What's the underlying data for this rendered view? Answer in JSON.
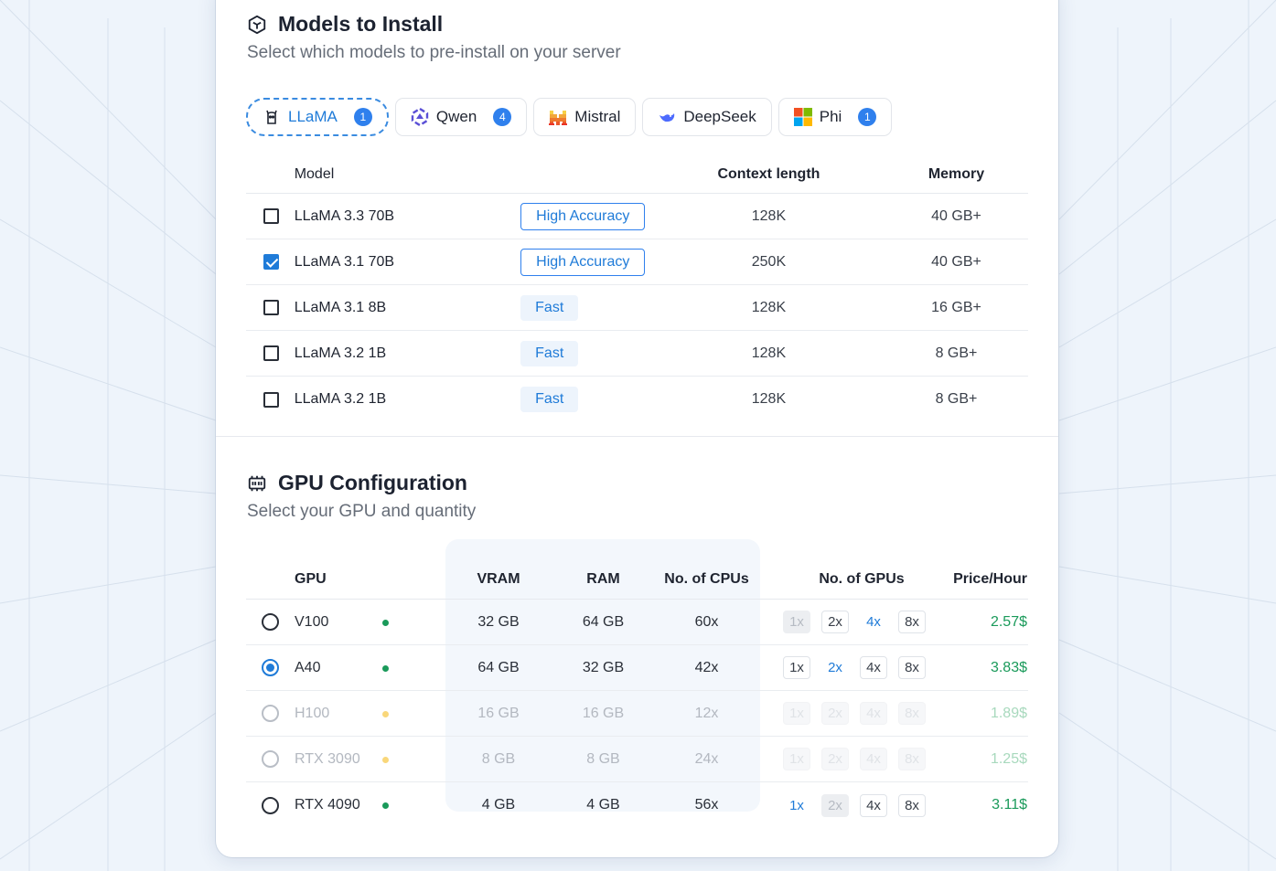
{
  "models_section": {
    "title": "Models to Install",
    "subtitle": "Select which models to pre-install on your server",
    "tabs": [
      {
        "label": "LLaMA",
        "count": "1",
        "active": true
      },
      {
        "label": "Qwen",
        "count": "4"
      },
      {
        "label": "Mistral",
        "count": ""
      },
      {
        "label": "DeepSeek",
        "count": ""
      },
      {
        "label": "Phi",
        "count": "1"
      }
    ],
    "headers": {
      "model": "Model",
      "context": "Context length",
      "memory": "Memory"
    },
    "rows": [
      {
        "name": "LLaMA 3.3 70B",
        "tag": "High Accuracy",
        "context": "128K",
        "memory": "40 GB+",
        "checked": false
      },
      {
        "name": "LLaMA 3.1 70B",
        "tag": "High Accuracy",
        "context": "250K",
        "memory": "40 GB+",
        "checked": true
      },
      {
        "name": "LLaMA 3.1 8B",
        "tag": "Fast",
        "context": "128K",
        "memory": "16 GB+",
        "checked": false
      },
      {
        "name": "LLaMA 3.2 1B",
        "tag": "Fast",
        "context": "128K",
        "memory": "8 GB+",
        "checked": false
      },
      {
        "name": "LLaMA 3.2 1B",
        "tag": "Fast",
        "context": "128K",
        "memory": "8 GB+",
        "checked": false
      }
    ]
  },
  "gpu_section": {
    "title": "GPU Configuration",
    "subtitle": "Select your GPU and quantity",
    "headers": {
      "gpu": "GPU",
      "vram": "VRAM",
      "ram": "RAM",
      "cpus": "No. of CPUs",
      "gpus": "No. of GPUs",
      "price": "Price/Hour"
    },
    "quantity_options": [
      "1x",
      "2x",
      "4x",
      "8x"
    ],
    "rows": [
      {
        "name": "V100",
        "status": "green",
        "vram": "32 GB",
        "ram": "64 GB",
        "cpus": "60x",
        "price": "2.57$",
        "selected": false,
        "available": true,
        "active_qty": "4x",
        "disabled_qty": "1x"
      },
      {
        "name": "A40",
        "status": "green",
        "vram": "64 GB",
        "ram": "32 GB",
        "cpus": "42x",
        "price": "3.83$",
        "selected": true,
        "available": true,
        "active_qty": "2x",
        "disabled_qty": ""
      },
      {
        "name": "H100",
        "status": "amber",
        "vram": "16 GB",
        "ram": "16 GB",
        "cpus": "12x",
        "price": "1.89$",
        "selected": false,
        "available": false,
        "active_qty": "",
        "disabled_qty": ""
      },
      {
        "name": "RTX 3090",
        "status": "amber",
        "vram": "8 GB",
        "ram": "8 GB",
        "cpus": "24x",
        "price": "1.25$",
        "selected": false,
        "available": false,
        "active_qty": "",
        "disabled_qty": ""
      },
      {
        "name": "RTX 4090",
        "status": "green",
        "vram": "4 GB",
        "ram": "4 GB",
        "cpus": "56x",
        "price": "3.11$",
        "selected": false,
        "available": true,
        "active_qty": "1x",
        "disabled_qty": "2x"
      }
    ]
  },
  "colors": {
    "accent": "#1f7bd8",
    "price_green": "#1a9a5a",
    "status_amber": "#f9d77a"
  }
}
